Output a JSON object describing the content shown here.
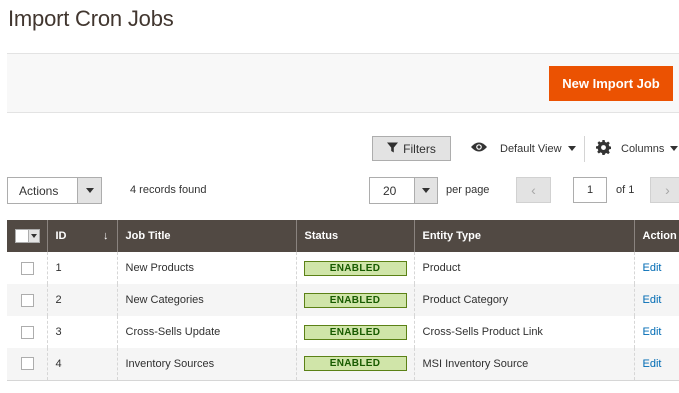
{
  "page": {
    "title": "Import Cron Jobs"
  },
  "page_actions": {
    "new_button": "New Import Job"
  },
  "toolbar": {
    "filters": "Filters",
    "view": "Default View",
    "columns": "Columns",
    "mass_actions": "Actions",
    "records_found": "4 records found",
    "page_size": "20",
    "per_page": "per page",
    "current_page": "1",
    "total_pages_label": "of 1"
  },
  "grid": {
    "columns": {
      "id": "ID",
      "job_title": "Job Title",
      "status": "Status",
      "entity_type": "Entity Type",
      "action": "Action"
    },
    "sort_indicator": "↓",
    "rows": [
      {
        "id": "1",
        "job_title": "New Products",
        "status": "ENABLED",
        "entity_type": "Product",
        "action": "Edit"
      },
      {
        "id": "2",
        "job_title": "New Categories",
        "status": "ENABLED",
        "entity_type": "Product Category",
        "action": "Edit"
      },
      {
        "id": "3",
        "job_title": "Cross-Sells Update",
        "status": "ENABLED",
        "entity_type": "Cross-Sells Product Link",
        "action": "Edit"
      },
      {
        "id": "4",
        "job_title": "Inventory Sources",
        "status": "ENABLED",
        "entity_type": "MSI Inventory Source",
        "action": "Edit"
      }
    ]
  },
  "colors": {
    "accent": "#eb5202",
    "header_bg": "#514943",
    "link": "#006bb4",
    "status_bg": "#d0e5a9",
    "status_text": "#185b00"
  },
  "icons": {
    "filters": "funnel-icon",
    "view": "eye-icon",
    "columns": "gear-icon"
  }
}
